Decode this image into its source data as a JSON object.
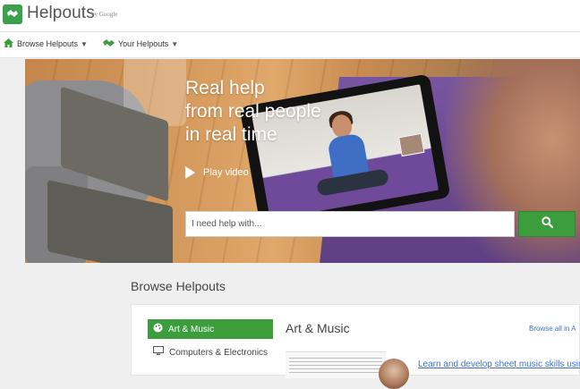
{
  "app": {
    "name": "Helpouts",
    "by": "by Google"
  },
  "nav": {
    "browse_label": "Browse Helpouts",
    "your_label": "Your Helpouts"
  },
  "hero": {
    "headline": [
      "Real help",
      "from real people",
      "in real time"
    ],
    "play_label": "Play video",
    "search_placeholder": "I need help with..."
  },
  "browse": {
    "title": "Browse Helpouts",
    "categories": [
      {
        "label": "Art & Music",
        "icon": "palette-icon",
        "active": true
      },
      {
        "label": "Computers & Electronics",
        "icon": "monitor-icon",
        "active": false
      }
    ],
    "current_category_title": "Art & Music",
    "browse_all_label": "Browse all in A",
    "featured_link": "Learn and develop sheet music skills usin"
  },
  "colors": {
    "brand_green": "#3c9d3c",
    "link_blue": "#3e73c4"
  }
}
